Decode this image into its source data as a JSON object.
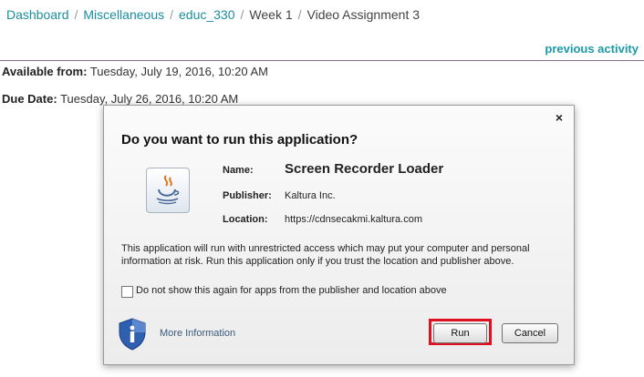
{
  "breadcrumb": {
    "items": [
      "Dashboard",
      "Miscellaneous",
      "educ_330",
      "Week 1",
      "Video Assignment 3"
    ],
    "separator": "/"
  },
  "previous_activity": "previous activity",
  "available": {
    "label": "Available from:",
    "value": "Tuesday, July 19, 2016, 10:20 AM"
  },
  "due": {
    "label": "Due Date:",
    "value": "Tuesday, July 26, 2016, 10:20 AM"
  },
  "dialog": {
    "close": "×",
    "title": "Do you want to run this application?",
    "name_label": "Name:",
    "name_value": "Screen Recorder Loader",
    "publisher_label": "Publisher:",
    "publisher_value": "Kaltura Inc.",
    "location_label": "Location:",
    "location_value": "https://cdnsecakmi.kaltura.com",
    "warning": "This application will run with unrestricted access which may put your computer and personal information at risk. Run this application only if you trust the location and publisher above.",
    "checkbox_label": "Do not show this again for apps from the publisher and location above",
    "more_info": "More Information",
    "run": "Run",
    "cancel": "Cancel"
  },
  "colors": {
    "link": "#1a8ea0",
    "highlight": "#e01020"
  },
  "icons": [
    "java-icon",
    "shield-info-icon",
    "close-icon"
  ]
}
